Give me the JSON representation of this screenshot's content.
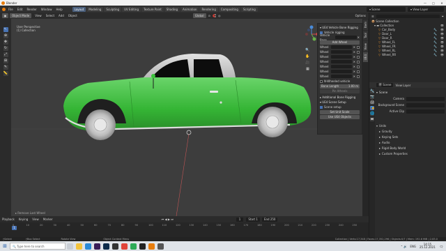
{
  "titlebar": {
    "app": "Blender"
  },
  "menubar": {
    "items": [
      "File",
      "Edit",
      "Render",
      "Window",
      "Help"
    ],
    "workspaces": [
      "Layout",
      "Modeling",
      "Sculpting",
      "UV Editing",
      "Texture Paint",
      "Shading",
      "Animation",
      "Rendering",
      "Compositing",
      "Scripting"
    ],
    "scene": "Scene",
    "view_layer": "View Layer"
  },
  "header3d": {
    "mode": "Object Mode",
    "menus": [
      "View",
      "Select",
      "Add",
      "Object"
    ],
    "orientation": "Global",
    "options": "Options"
  },
  "viewport": {
    "view_name": "User Perspective",
    "collection": "(1) Collection",
    "last_op": "Remove Last Wheel"
  },
  "npanel": {
    "title": "UE4 Vehicle Bone Rigging",
    "vehicle_rigging": "Vehicle rigging",
    "vehicle_base": "Vehicle Base",
    "add_wheel": "Add Wheel",
    "wheel_label": "Wheel",
    "n_wheeled": "N-Wheeled vehicle",
    "bone_length": "Bone Length",
    "bone_length_val": "1.00 m",
    "pin_wheels": "Pin Wheels",
    "additional": "Additional Bone Rigging",
    "scene_setup": "UE4 Scene Setup",
    "scene_setup_chk": "Scene setup",
    "set_unit": "Set Unit Scale",
    "use_ue4": "Use UE4 Objects",
    "tabs": [
      "Item",
      "Tool",
      "View",
      "UE4"
    ]
  },
  "outliner": {
    "search": "",
    "root": "Scene Collection",
    "collection": "Collection",
    "items": [
      "Car_Body",
      "Door_L",
      "Door_R",
      "Wheel_FL",
      "Wheel_FR",
      "Wheel_RL",
      "Wheel_RR"
    ]
  },
  "props": {
    "scene_tab": "Scene",
    "view_layer_tab": "View Layer",
    "header": "Scene",
    "camera": "Camera",
    "bg_scene": "Background Scene",
    "active_clip": "Active Clip",
    "sections": [
      "Units",
      "Gravity",
      "Keying Sets",
      "Audio",
      "Rigid Body World",
      "Custom Properties"
    ]
  },
  "timeline": {
    "menus": [
      "Playback",
      "Keying",
      "View",
      "Marker"
    ],
    "frame": "1",
    "start_label": "Start",
    "start": "1",
    "end_label": "End",
    "end": "250",
    "ticks": [
      "0",
      "10",
      "20",
      "30",
      "40",
      "50",
      "60",
      "70",
      "80",
      "90",
      "100",
      "110",
      "120",
      "130",
      "140",
      "150",
      "160",
      "170",
      "180",
      "190",
      "200",
      "210",
      "220",
      "230",
      "240",
      "250"
    ]
  },
  "status": {
    "left": "Select",
    "mid": "Box Select",
    "rotate": "Rotate View",
    "ctx": "Object Context Menu",
    "stats": "Collection | Verts:17,348 | Faces:17,352,296 | Objects:0/7 | Mem: 192.8 MiB | 2.83.0"
  },
  "taskbar": {
    "search": "Type here to search",
    "time": "14:15",
    "date": "25.12.2021",
    "lang": "ENG"
  }
}
